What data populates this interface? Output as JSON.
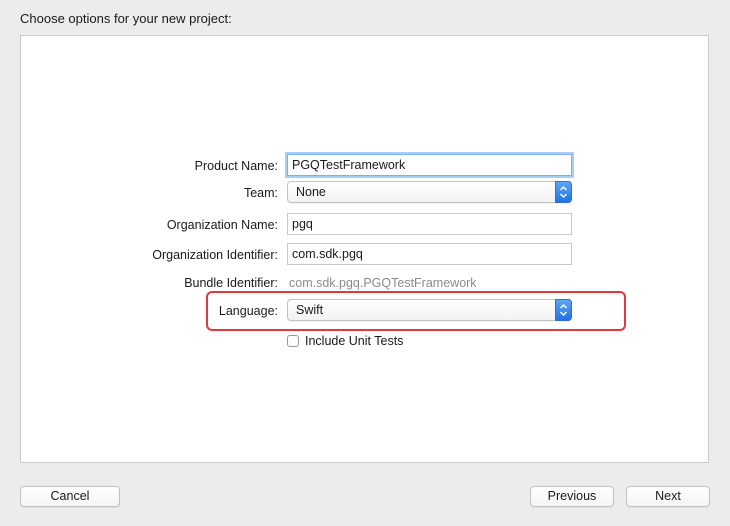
{
  "heading": "Choose options for your new project:",
  "form": {
    "product_name": {
      "label": "Product Name:",
      "value": "PGQTestFramework"
    },
    "team": {
      "label": "Team:",
      "value": "None"
    },
    "organization_name": {
      "label": "Organization Name:",
      "value": "pgq"
    },
    "organization_identifier": {
      "label": "Organization Identifier:",
      "value": "com.sdk.pgq"
    },
    "bundle_identifier": {
      "label": "Bundle Identifier:",
      "value": "com.sdk.pgq.PGQTestFramework"
    },
    "language": {
      "label": "Language:",
      "value": "Swift"
    },
    "include_unit_tests": {
      "label": "Include Unit Tests",
      "checked": false
    }
  },
  "buttons": {
    "cancel": "Cancel",
    "previous": "Previous",
    "next": "Next"
  },
  "colors": {
    "highlight": "#e03a3a",
    "accent": "#1f74e8"
  }
}
